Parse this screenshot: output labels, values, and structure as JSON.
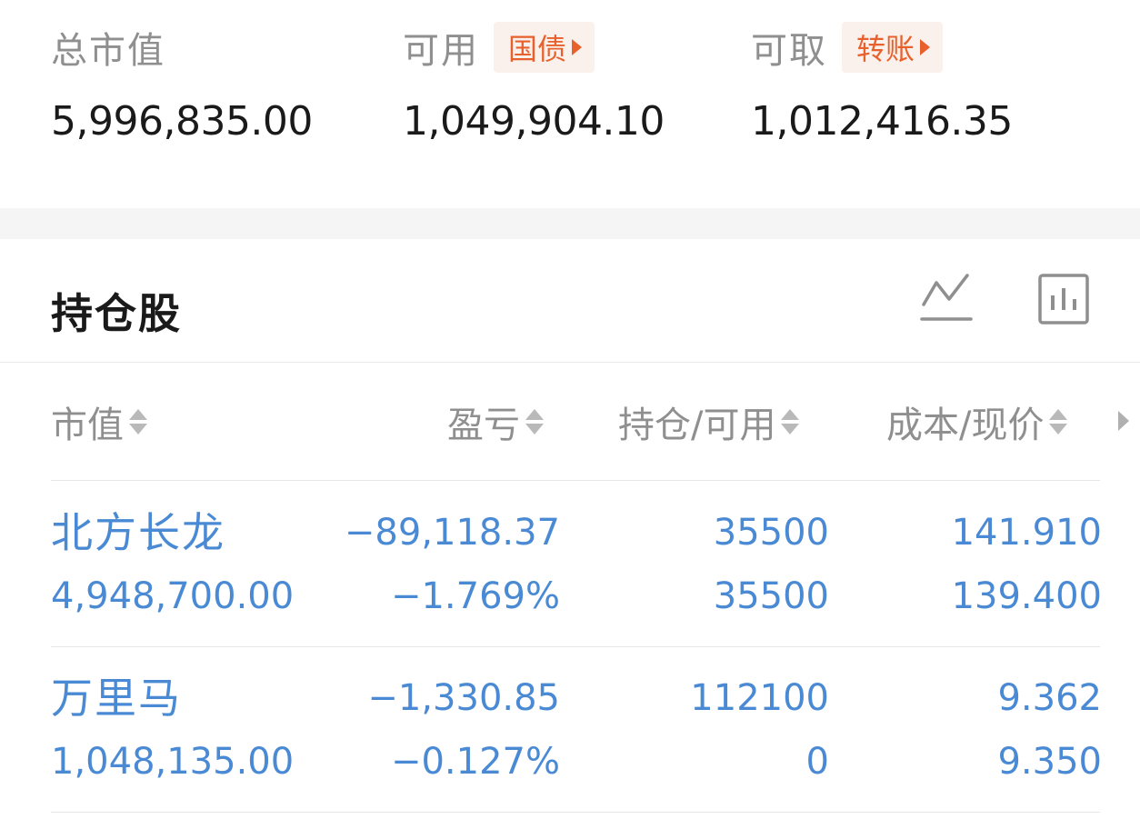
{
  "summary": {
    "total_value": {
      "label": "总市值",
      "value": "5,996,835.00"
    },
    "available": {
      "label": "可用",
      "tag": "国债",
      "value": "1,049,904.10"
    },
    "withdrawable": {
      "label": "可取",
      "tag": "转账",
      "value": "1,012,416.35"
    }
  },
  "holdings": {
    "title": "持仓股",
    "icons": [
      "line-chart-icon",
      "bar-chart-icon"
    ],
    "columns": [
      "市值",
      "盈亏",
      "持仓/可用",
      "成本/现价"
    ],
    "rows": [
      {
        "name": "北方长龙",
        "market_value": "4,948,700.00",
        "pnl": "−89,118.37",
        "pnl_pct": "−1.769%",
        "position": "35500",
        "available": "35500",
        "cost": "141.910",
        "price": "139.400"
      },
      {
        "name": "万里马",
        "market_value": "1,048,135.00",
        "pnl": "−1,330.85",
        "pnl_pct": "−0.127%",
        "position": "112100",
        "available": "0",
        "cost": "9.362",
        "price": "9.350"
      }
    ]
  },
  "colors": {
    "accent_orange": "#e8602c",
    "tag_bg": "#fbf1ec",
    "stock_blue": "#4a8ad4",
    "label_gray": "#8f8f8f"
  }
}
